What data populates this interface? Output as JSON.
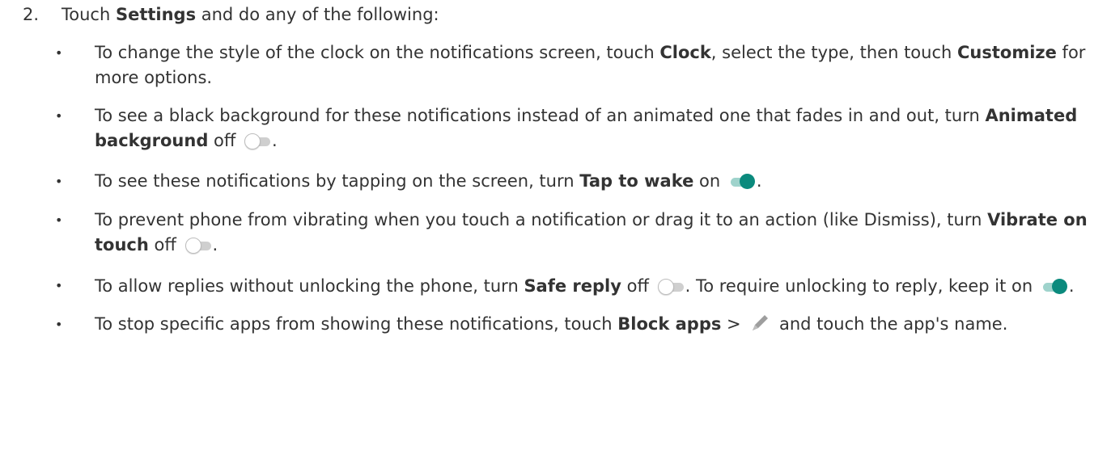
{
  "step": {
    "number": "2.",
    "text_before": "Touch ",
    "bold": "Settings",
    "text_after": " and do any of the following:"
  },
  "bullets": [
    {
      "t1": "To change the style of the clock on the notifications screen, touch ",
      "b1": "Clock",
      "t2": ", select the type, then touch ",
      "b2": "Customize",
      "t3": " for more options."
    },
    {
      "t1": "To see a black background for these notifications instead of an animated one that fades in and out, turn ",
      "b1": "Animated background",
      "t2": " off ",
      "toggle": "off",
      "t3": "."
    },
    {
      "t1": "To see these notifications by tapping on the screen, turn ",
      "b1": "Tap to wake",
      "t2": " on ",
      "toggle": "on",
      "t3": "."
    },
    {
      "t1": "To prevent phone from vibrating when you touch a notification or drag it to an action (like Dismiss), turn ",
      "b1": "Vibrate on touch",
      "t2": " off ",
      "toggle": "off",
      "t3": "."
    },
    {
      "t1": "To allow replies without unlocking the phone, turn ",
      "b1": "Safe reply",
      "t2": " off ",
      "toggle1": "off",
      "t3": ". To require unlocking to reply, keep it on ",
      "toggle2": "on",
      "t4": "."
    },
    {
      "t1": "To stop specific apps from showing these notifications, touch ",
      "b1": "Block apps",
      "t2": " > ",
      "icon": "pencil-icon",
      "t3": " and touch the app's name."
    }
  ],
  "bullet_char": "•",
  "colors": {
    "text": "#333333",
    "toggle_on": "#0b8a7d",
    "toggle_on_track": "#9fd3cc",
    "toggle_off_track": "#cfcfcf",
    "pencil": "#9e9e9e"
  }
}
